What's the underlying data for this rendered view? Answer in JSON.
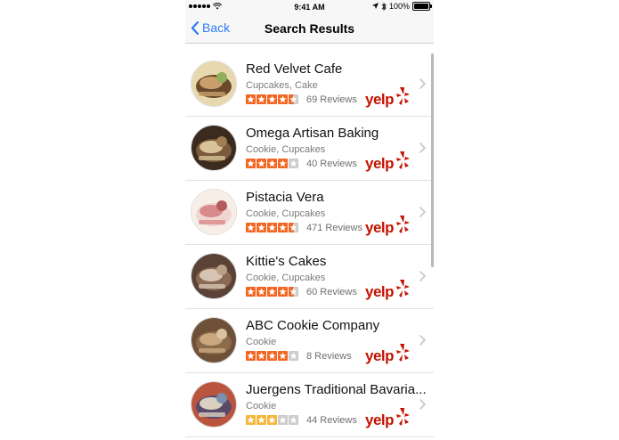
{
  "status_bar": {
    "time": "9:41 AM",
    "battery": "100%",
    "icons": [
      "signal-dots-icon",
      "wifi-icon",
      "location-icon",
      "bluetooth-icon",
      "battery-icon"
    ]
  },
  "nav": {
    "back_label": "Back",
    "title": "Search Results"
  },
  "colors": {
    "accent_blue": "#2f7cf6",
    "star_orange": "#f26522",
    "star_light": "#f4b73b",
    "star_empty": "#cccccc",
    "yelp_red": "#c41200"
  },
  "results": [
    {
      "name": "Red Velvet Cafe",
      "categories": "Cupcakes, Cake",
      "rating": 4.5,
      "reviews": "69 Reviews",
      "brand": "yelp",
      "thumb": "food-photo-cafe"
    },
    {
      "name": "Omega Artisan Baking",
      "categories": "Cookie, Cupcakes",
      "rating": 4,
      "reviews": "40 Reviews",
      "brand": "yelp",
      "thumb": "food-photo-cookie"
    },
    {
      "name": "Pistacia Vera",
      "categories": "Cookie, Cupcakes",
      "rating": 4.5,
      "reviews": "471 Reviews",
      "brand": "yelp",
      "thumb": "food-photo-macaron"
    },
    {
      "name": "Kittie's Cakes",
      "categories": "Cookie, Cupcakes",
      "rating": 4.5,
      "reviews": "60 Reviews",
      "brand": "yelp",
      "thumb": "food-photo-sandwich"
    },
    {
      "name": "ABC Cookie Company",
      "categories": "Cookie",
      "rating": 4,
      "reviews": "8 Reviews",
      "brand": "yelp",
      "thumb": "food-photo-cookies"
    },
    {
      "name": "Juergens Traditional Bavaria...",
      "categories": "Cookie",
      "rating": 3,
      "reviews": "44 Reviews",
      "brand": "yelp",
      "thumb": "food-photo-pastry"
    }
  ]
}
